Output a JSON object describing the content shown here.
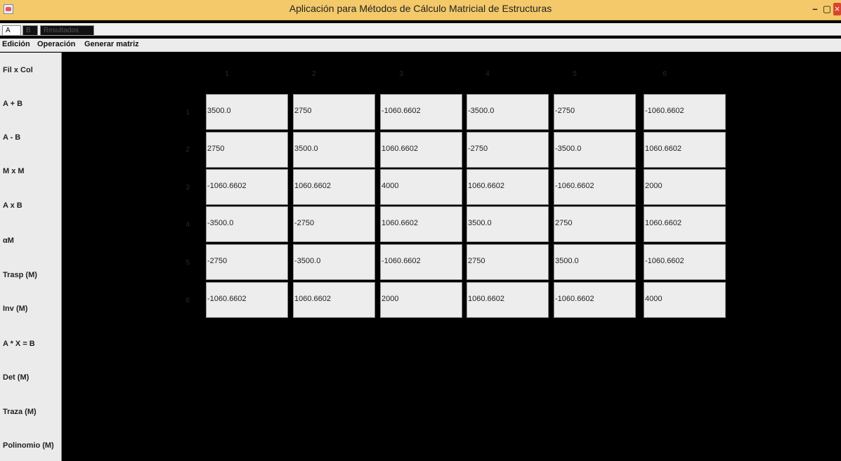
{
  "window": {
    "title": "Aplicación para Métodos de Cálculo Matricial de Estructuras",
    "icon": "java-icon",
    "controls": {
      "minimize": "–",
      "maximize": "▢",
      "close": "×"
    }
  },
  "tabs": [
    {
      "label": "A",
      "selected": true
    },
    {
      "label": "B",
      "selected": false
    },
    {
      "label": "Resultados",
      "selected": false
    }
  ],
  "menu": [
    "Edición",
    "Operación",
    "Generar matriz"
  ],
  "sidebar": [
    "Fil x Col",
    "A + B",
    "A - B",
    "M x M",
    "A x B",
    "αM",
    "Trasp (M)",
    "Inv (M)",
    "A * X = B",
    "Det (M)",
    "Traza (M)",
    "Polinomio (M)"
  ],
  "matrix": {
    "col_headers": [
      "1",
      "2",
      "3",
      "4",
      "5",
      "6"
    ],
    "row_headers": [
      "1",
      "2",
      "3",
      "4",
      "5",
      "6"
    ],
    "rows": [
      [
        "3500.0",
        "2750",
        "-1060.6602",
        "-3500.0",
        "-2750",
        "-1060.6602"
      ],
      [
        "2750",
        "3500.0",
        "1060.6602",
        "-2750",
        "-3500.0",
        "1060.6602"
      ],
      [
        "-1060.6602",
        "1060.6602",
        "4000",
        "1060.6602",
        "-1060.6602",
        "2000"
      ],
      [
        "-3500.0",
        "-2750",
        "1060.6602",
        "3500.0",
        "2750",
        "1060.6602"
      ],
      [
        "-2750",
        "-3500.0",
        "-1060.6602",
        "2750",
        "3500.0",
        "-1060.6602"
      ],
      [
        "-1060.6602",
        "1060.6602",
        "2000",
        "1060.6602",
        "-1060.6602",
        "4000"
      ]
    ]
  }
}
